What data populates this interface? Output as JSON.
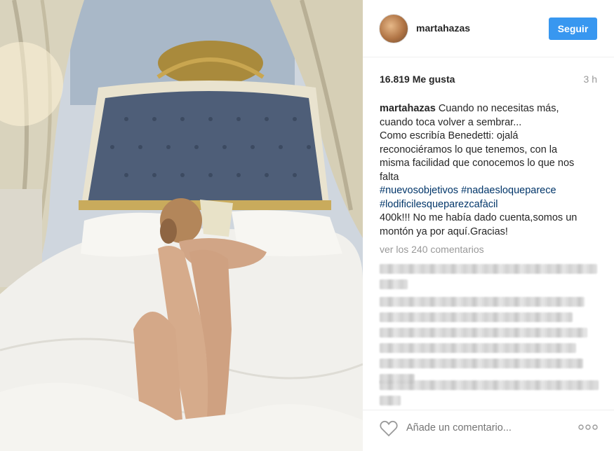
{
  "post": {
    "username": "martahazas",
    "follow_label": "Seguir",
    "likes": "16.819 Me gusta",
    "time_ago": "3 h",
    "caption_user": "martahazas",
    "caption_lines": [
      "Cuando no necesitas más,",
      "cuando toca volver a sembrar...",
      "Como escribía Benedetti: ojalá",
      "reconociéramos lo que tenemos, con la",
      "misma facilidad que conocemos lo que nos",
      "falta"
    ],
    "hashtags_line1": "#nuevosobjetivos #nadaesloqueparece",
    "hashtags_line2": "#lodificilesqueparezcafàcil",
    "caption_tail_lines": [
      "400k!!! No me había dado cuenta,somos un",
      "montón ya por aquí.Gracias!"
    ],
    "view_comments": "ver los 240 comentarios",
    "comment_placeholder": "Añade un comentario...",
    "icons": {
      "like": "heart-icon",
      "more": "more-options-icon"
    },
    "colors": {
      "follow_button": "#3897f0",
      "hashtag": "#003569",
      "muted": "#999999"
    }
  }
}
